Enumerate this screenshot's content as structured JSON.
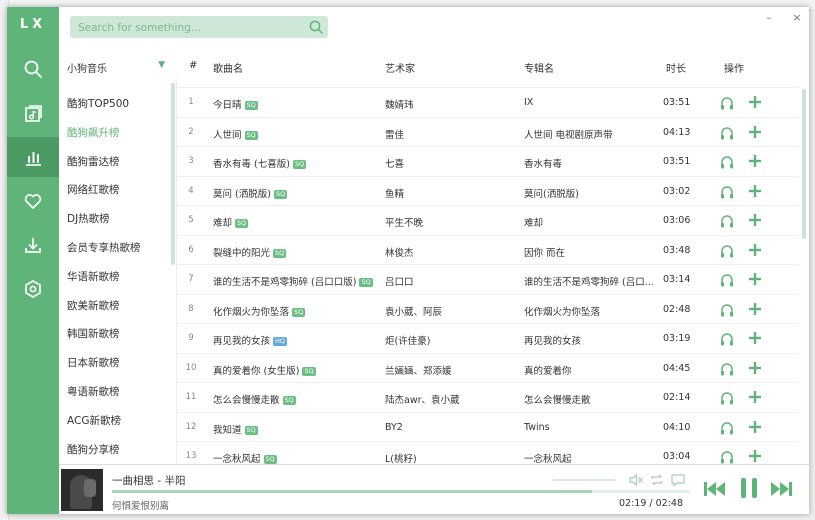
{
  "app": {
    "logo": "LX"
  },
  "colors": {
    "accent": "#5fb579",
    "accent_dark": "#4d9b64",
    "light": "#cfe7d6"
  },
  "nav": [
    {
      "icon": "search-icon"
    },
    {
      "icon": "music-library-icon"
    },
    {
      "icon": "leaderboard-icon",
      "active": true
    },
    {
      "icon": "heart-icon"
    },
    {
      "icon": "download-icon"
    },
    {
      "icon": "settings-icon"
    }
  ],
  "search": {
    "placeholder": "Search for something..."
  },
  "window": {
    "minimize": "–",
    "close": "×"
  },
  "source": {
    "label": "小狗音乐"
  },
  "columns": {
    "num": "#",
    "name": "歌曲名",
    "artist": "艺术家",
    "album": "专辑名",
    "duration": "时长",
    "actions": "操作"
  },
  "leaderboards": [
    "酷狗TOP500",
    "酷狗飙升榜",
    "酷狗雷达榜",
    "网络红歌榜",
    "DJ热歌榜",
    "会员专享热歌榜",
    "华语新歌榜",
    "欧美新歌榜",
    "韩国新歌榜",
    "日本新歌榜",
    "粤语新歌榜",
    "ACG新歌榜",
    "酷狗分享榜"
  ],
  "active_leaderboard_index": 1,
  "songs": [
    {
      "num": "1",
      "name": "今日晴",
      "quality": "SQ",
      "artist": "魏婧玮",
      "album": "IX",
      "duration": "03:51"
    },
    {
      "num": "2",
      "name": "人世间",
      "quality": "SQ",
      "artist": "雷佳",
      "album": "人世间 电视剧原声带",
      "duration": "04:13"
    },
    {
      "num": "3",
      "name": "香水有毒 (七喜版)",
      "quality": "SQ",
      "artist": "七喜",
      "album": "香水有毒",
      "duration": "03:51"
    },
    {
      "num": "4",
      "name": "莫问 (洒脱版)",
      "quality": "SQ",
      "artist": "鱼精",
      "album": "莫问(洒脱版)",
      "duration": "03:02"
    },
    {
      "num": "5",
      "name": "难却",
      "quality": "SQ",
      "artist": "平生不晚",
      "album": "难却",
      "duration": "03:06"
    },
    {
      "num": "6",
      "name": "裂缝中的阳光",
      "quality": "SQ",
      "artist": "林俊杰",
      "album": "因你 而在",
      "duration": "03:48"
    },
    {
      "num": "7",
      "name": "谁的生活不是鸡零狗碎 (吕口口版)",
      "quality": "SQ",
      "artist": "吕口口",
      "album": "谁的生活不是鸡零狗碎 (吕口...",
      "duration": "03:14"
    },
    {
      "num": "8",
      "name": "化作烟火为你坠落",
      "quality": "SQ",
      "artist": "袁小葳、阿辰",
      "album": "化作烟火为你坠落",
      "duration": "02:48"
    },
    {
      "num": "9",
      "name": "再见我的女孩",
      "quality": "HQ",
      "artist": "炬(许佳豪)",
      "album": "再见我的女孩",
      "duration": "03:19"
    },
    {
      "num": "10",
      "name": "真的爱着你 (女生版)",
      "quality": "SQ",
      "artist": "兰婳婳、郑添媛",
      "album": "真的爱着你",
      "duration": "04:45"
    },
    {
      "num": "11",
      "name": "怎么会慢慢走散",
      "quality": "SQ",
      "artist": "陆杰awr、袁小葳",
      "album": "怎么会慢慢走散",
      "duration": "02:14"
    },
    {
      "num": "12",
      "name": "我知道",
      "quality": "SQ",
      "artist": "BY2",
      "album": "Twins",
      "duration": "04:10"
    },
    {
      "num": "13",
      "name": "一念秋风起",
      "quality": "SQ",
      "artist": "L(桃籽)",
      "album": "一念秋风起",
      "duration": "03:04"
    }
  ],
  "player": {
    "title": "一曲相思 - 半阳",
    "subtitle": "何惧爱恨别离",
    "time": "02:19 / 02:48",
    "progress": 0.83
  }
}
